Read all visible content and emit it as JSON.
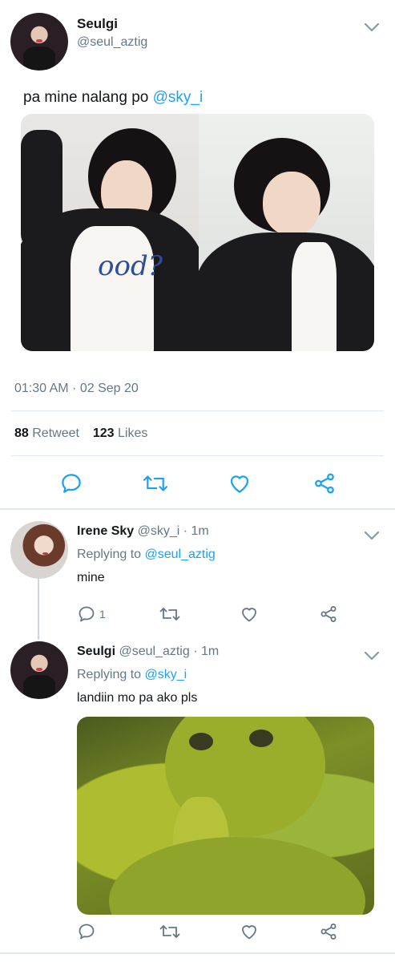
{
  "main_tweet": {
    "author_name": "Seulgi",
    "author_handle": "@seul_aztig",
    "text_prefix": "pa mine nalang po",
    "text_mention": "@sky_i",
    "photo_text": "ood?",
    "timestamp": "01:30 AM · 02 Sep 20",
    "retweet_count": "88",
    "retweet_label": "Retweet",
    "likes_count": "123",
    "likes_label": "Likes"
  },
  "replies": [
    {
      "author_name": "Irene Sky",
      "meta": "@sky_i · 1m",
      "replying_prefix": "Replying to",
      "replying_handle": "@seul_aztig",
      "text": "mine",
      "reply_count": "1"
    },
    {
      "author_name": "Seulgi",
      "meta": "@seul_aztig · 1m",
      "replying_prefix": "Replying to",
      "replying_handle": "@sky_i",
      "text": "landiin mo pa ako pls",
      "reply_count": ""
    }
  ],
  "icons": {
    "reply": "reply-icon",
    "retweet": "retweet-icon",
    "like": "heart-icon",
    "share": "share-icon",
    "more": "chevron-down-icon"
  },
  "colors": {
    "accent": "#1da1f2",
    "muted": "#657786",
    "divider": "#e1e8ed"
  }
}
